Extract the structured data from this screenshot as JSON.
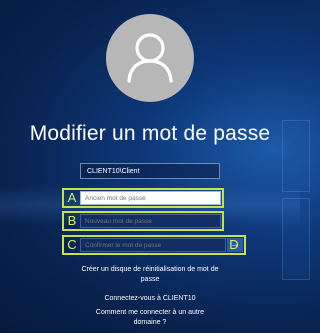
{
  "title": "Modifier un mot de passe",
  "username": "CLIENT10\\Client",
  "fields": [
    {
      "letter": "A",
      "placeholder": "Ancien mot de passe"
    },
    {
      "letter": "B",
      "placeholder": "Nouveau mot de passe"
    },
    {
      "letter": "C",
      "placeholder": "Confirmer le mot de passe"
    }
  ],
  "submit_symbol": "→",
  "submit_letter": "D",
  "links": {
    "reset_disk": "Créer un disque de réinitialisation de mot de passe",
    "connect": "Connectez-vous à CLIENT10",
    "other_domain": "Comment me connecter à un autre domaine ?"
  },
  "icons": {
    "avatar": "user-icon",
    "submit": "arrow-right-icon"
  },
  "colors": {
    "highlight": "#c6e04a",
    "background": "#0d3677"
  }
}
